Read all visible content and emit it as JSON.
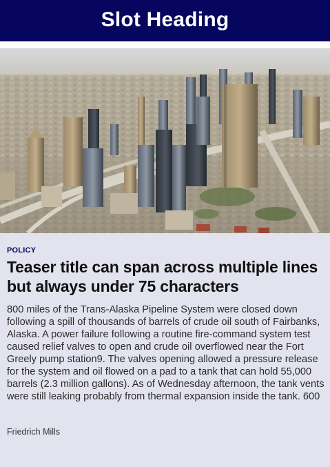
{
  "slot": {
    "heading": "Slot Heading"
  },
  "teaser": {
    "image_alt": "Aerial view of a city skyline with skyscrapers and highways",
    "section": "POLICY",
    "title": "Teaser title can span across multiple lines but always under 75 characters",
    "body": "800 miles of the Trans-Alaska Pipeline System were closed down following a spill of thousands of barrels of crude oil south of Fairbanks, Alaska. A power failure following a routine fire-command system test caused relief valves to open and crude oil overflowed near the Fort Greely pump station9. The valves opening allowed a pressure release for the system and oil flowed on a pad to a tank that can hold 55,000 barrels (2.3 million gallons). As of Wednesday afternoon, the tank vents were still leaking probably from thermal expansion inside the tank. 600",
    "author": "Friedrich Mills"
  },
  "colors": {
    "header_bg": "#06065f",
    "card_bg": "#e3e3ef",
    "section_label": "#06065f"
  }
}
